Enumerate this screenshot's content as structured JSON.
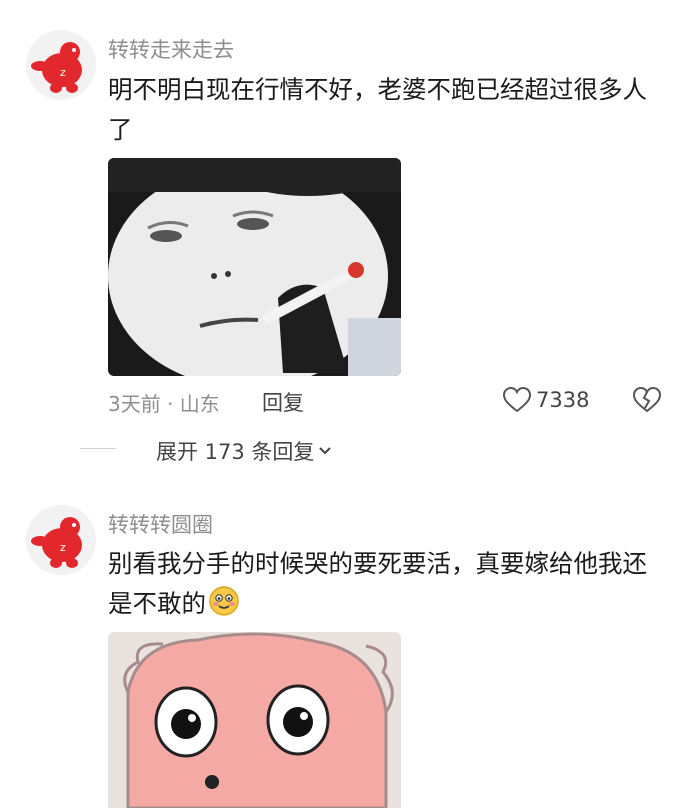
{
  "comments": [
    {
      "username": "转转走来走去",
      "text": "明不明白现在行情不好，老婆不跑已经超过很多人了",
      "meta": "3天前 · 山东",
      "reply_label": "回复",
      "likes": "7338",
      "expand_label": "展开 173 条回复",
      "avatar_icon": "red-mascot-avatar",
      "meme": "pale-face-smoking-meme"
    },
    {
      "username": "转转转圆圈",
      "text": "别看我分手的时候哭的要死要活，真要嫁给他我还是不敢的",
      "emoji": "blushing-smile-emoji",
      "avatar_icon": "red-mascot-avatar",
      "meme": "pink-cartoon-face-meme"
    }
  ],
  "colors": {
    "username": "#8e8e8e",
    "text": "#1a1a1a",
    "mascot": "#e2282c"
  }
}
